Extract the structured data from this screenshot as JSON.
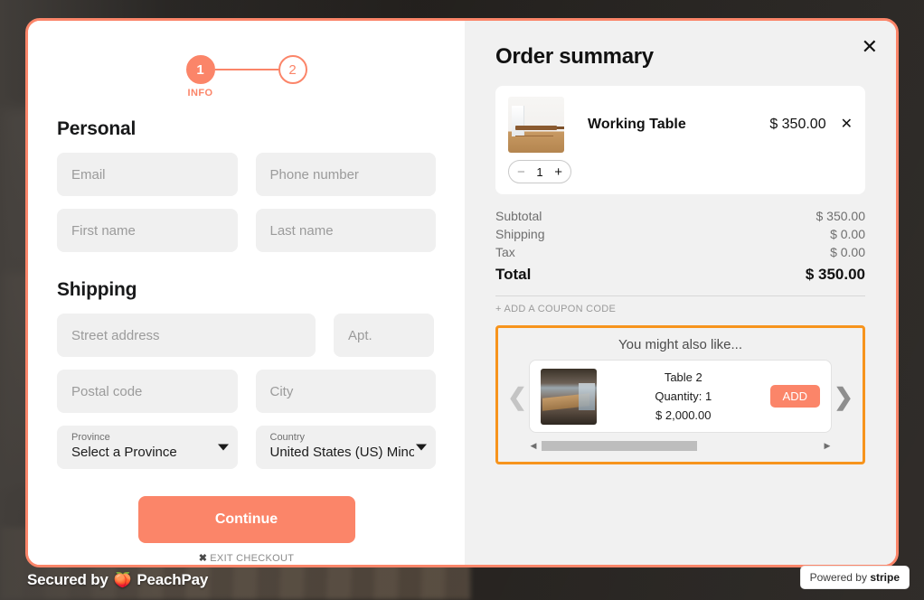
{
  "stepper": {
    "step1": "1",
    "step1_label": "INFO",
    "step2": "2"
  },
  "form": {
    "personal_heading": "Personal",
    "shipping_heading": "Shipping",
    "email_placeholder": "Email",
    "phone_placeholder": "Phone number",
    "first_name_placeholder": "First name",
    "last_name_placeholder": "Last name",
    "street_placeholder": "Street address",
    "apt_placeholder": "Apt.",
    "postal_placeholder": "Postal code",
    "city_placeholder": "City",
    "province_label": "Province",
    "province_value": "Select a Province",
    "country_label": "Country",
    "country_value": "United States (US) Minor O",
    "continue_label": "Continue",
    "exit_label": "EXIT CHECKOUT",
    "exit_icon": "✖"
  },
  "summary": {
    "title": "Order summary",
    "close_icon": "✕",
    "item": {
      "name": "Working Table",
      "price": "$ 350.00",
      "remove_icon": "✕",
      "qty": "1",
      "minus": "−",
      "plus": "+"
    },
    "totals": [
      {
        "label": "Subtotal",
        "value": "$ 350.00"
      },
      {
        "label": "Shipping",
        "value": "$ 0.00"
      },
      {
        "label": "Tax",
        "value": "$ 0.00"
      }
    ],
    "grand_label": "Total",
    "grand_value": "$ 350.00",
    "coupon_label": "+ ADD A COUPON CODE"
  },
  "recommendations": {
    "title": "You might also like...",
    "prev_icon": "❮",
    "next_icon": "❯",
    "scroll_left_icon": "◀",
    "scroll_right_icon": "▶",
    "card": {
      "name": "Table 2",
      "quantity": "Quantity: 1",
      "price": "$ 2,000.00",
      "add_label": "ADD"
    }
  },
  "footer": {
    "secured_prefix": "Secured by",
    "secured_brand": "PeachPay",
    "peach_icon": "🍑",
    "stripe_prefix": "Powered by",
    "stripe_brand": "stripe"
  },
  "colors": {
    "accent": "#fb8569",
    "highlight": "#f7941d",
    "panel": "#f1f1f1",
    "field": "#f0f0f0"
  }
}
